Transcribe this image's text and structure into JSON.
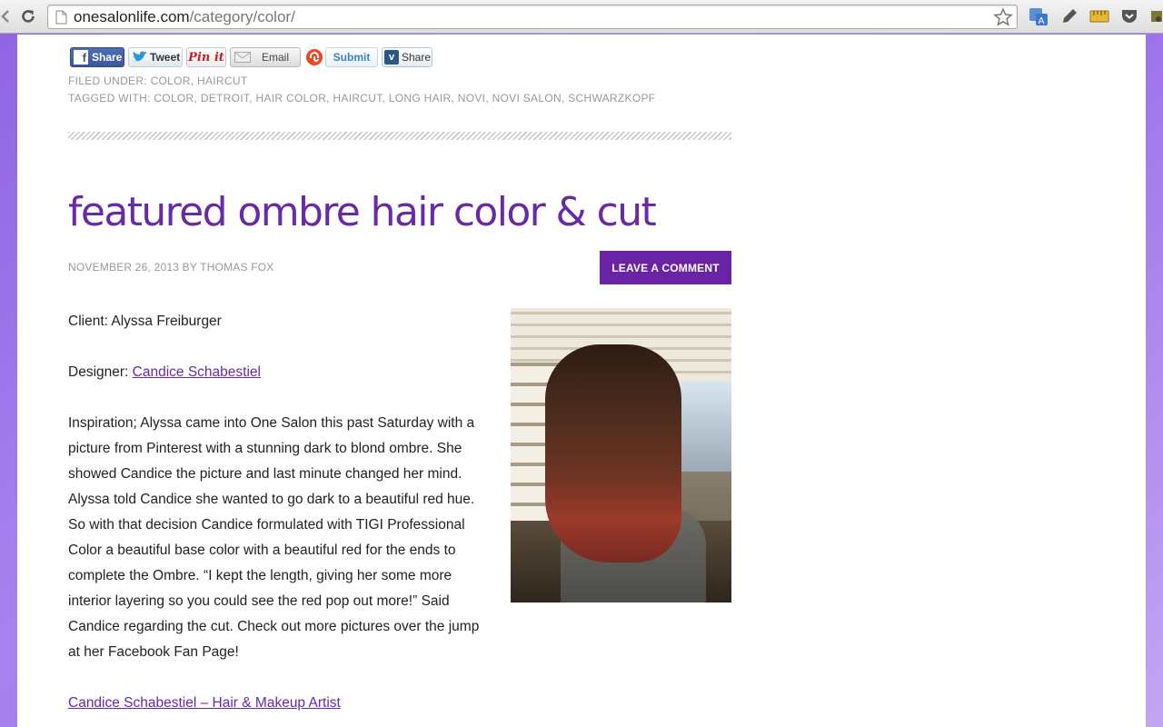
{
  "browser": {
    "url_host": "onesalonlife.com",
    "url_path": "/category/color/"
  },
  "share_bar": {
    "facebook": "Share",
    "twitter": "Tweet",
    "pinterest": "Pin it",
    "email": "Email",
    "stumbleupon": "Submit",
    "vk": "Share"
  },
  "meta": {
    "filed_under": "FILED UNDER: COLOR, HAIRCUT",
    "tagged_with": "TAGGED WITH: COLOR, DETROIT, HAIR COLOR, HAIRCUT, LONG HAIR, NOVI, NOVI SALON, SCHWARZKOPF"
  },
  "post": {
    "title": "featured ombre hair color & cut",
    "byline": "NOVEMBER 26, 2013 BY THOMAS FOX",
    "leave_comment": "LEAVE A COMMENT",
    "client": "Client: Alyssa Freiburger",
    "designer_label": "Designer: ",
    "designer_link": "Candice Schabestiel",
    "inspiration": "Inspiration; Alyssa came into One Salon this past Saturday with a picture from Pinterest with a stunning dark to blond ombre. She showed Candice the picture and last minute changed her mind. Alyssa told Candice she wanted to go dark to a beautiful red hue. So with that decision Candice formulated with TIGI Professional Color a beautiful base color with a beautiful red for the ends to complete the Ombre. “I kept the length, giving her some more interior layering so you could see the red pop out more!” Said Candice regarding the cut. Check out more pictures over the jump at her Facebook Fan Page!",
    "footer_link": "Candice Schabestiel – Hair & Makeup Artist"
  },
  "colors": {
    "accent": "#6a2aa6",
    "page_bg": "#9a70ea"
  }
}
